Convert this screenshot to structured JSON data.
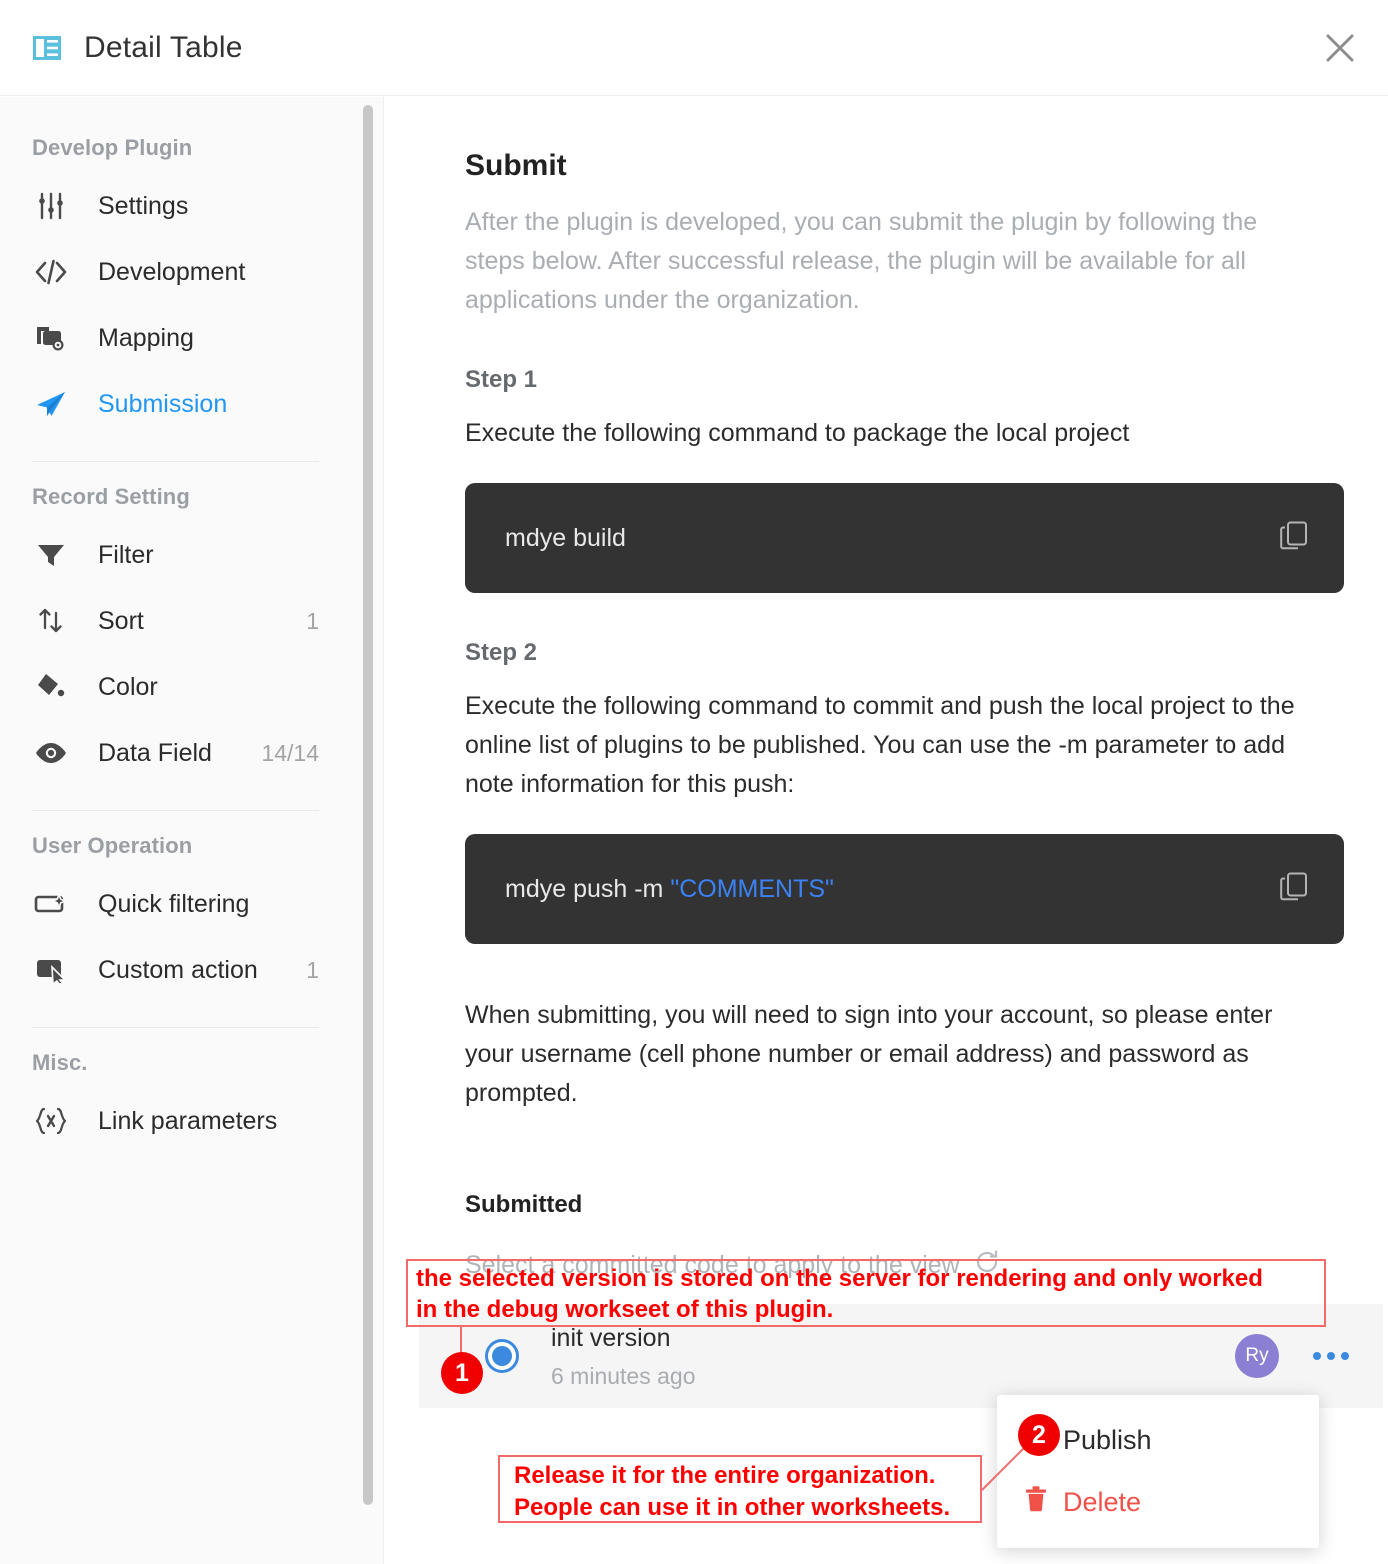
{
  "titlebar": {
    "icon": "detail-table-icon",
    "title": "Detail Table",
    "close_label": "×",
    "accent": "#5bc0de"
  },
  "sidebar": {
    "sections": [
      {
        "title": "Develop Plugin",
        "items": [
          {
            "icon": "sliders-icon",
            "label": "Settings",
            "count": ""
          },
          {
            "icon": "code-icon",
            "label": "Development",
            "count": ""
          },
          {
            "icon": "mapping-icon",
            "label": "Mapping",
            "count": ""
          },
          {
            "icon": "send-icon",
            "label": "Submission",
            "count": "",
            "active": true
          }
        ]
      },
      {
        "title": "Record Setting",
        "items": [
          {
            "icon": "filter-icon",
            "label": "Filter",
            "count": ""
          },
          {
            "icon": "sort-icon",
            "label": "Sort",
            "count": "1"
          },
          {
            "icon": "paint-bucket-icon",
            "label": "Color",
            "count": ""
          },
          {
            "icon": "eye-icon",
            "label": "Data Field",
            "count": "14/14"
          }
        ]
      },
      {
        "title": "User Operation",
        "items": [
          {
            "icon": "quick-filter-icon",
            "label": "Quick filtering",
            "count": ""
          },
          {
            "icon": "custom-action-icon",
            "label": "Custom action",
            "count": "1"
          }
        ]
      },
      {
        "title": "Misc.",
        "items": [
          {
            "icon": "braces-icon",
            "label": "Link parameters",
            "count": ""
          }
        ]
      }
    ],
    "active_color": "#2196f3"
  },
  "main": {
    "heading": "Submit",
    "description": "After the plugin is developed, you can submit the plugin by following the steps below. After successful release, the plugin will be available for all applications under the organization.",
    "step1": {
      "heading": "Step 1",
      "text": "Execute the following command to package the local project",
      "command": "mdye build",
      "copy_icon": "copy-icon"
    },
    "step2": {
      "heading": "Step 2",
      "text": "Execute the following command to commit and push the local project to the online list of plugins to be published. You can use the -m parameter to add note information for this push:",
      "command_prefix": "mdye push -m ",
      "command_arg": "\"COMMENTS\"",
      "copy_icon": "copy-icon"
    },
    "note": "When submitting, you will need to sign into your account, so please enter your username (cell phone number or email address) and password as prompted.",
    "submitted": {
      "heading": "Submitted",
      "hint": "Select a committed code to apply to the view",
      "refresh_icon": "refresh-icon",
      "versions": [
        {
          "name": "init version",
          "time": "6 minutes ago",
          "selected": true,
          "avatar_initials": "Ry",
          "avatar_color": "#8b7fd4",
          "more_icon": "more-dots-icon"
        }
      ]
    }
  },
  "context_menu": {
    "items": [
      {
        "label": "Publish",
        "icon": "",
        "danger": false
      },
      {
        "label": "Delete",
        "icon": "trash-icon",
        "danger": true
      }
    ],
    "danger_color": "#f0524a"
  },
  "annotations": {
    "color": "#ff0000",
    "box_border": "#f26b6b",
    "items": [
      {
        "id": "anno1",
        "line1": "the selected version is stored on the server for rendering and only worked",
        "line2": "in the debug workseet of this plugin."
      },
      {
        "id": "anno2",
        "line1": "Release it for the entire organization.",
        "line2": "People can use it in other worksheets."
      }
    ],
    "badges": [
      "1",
      "2"
    ]
  }
}
